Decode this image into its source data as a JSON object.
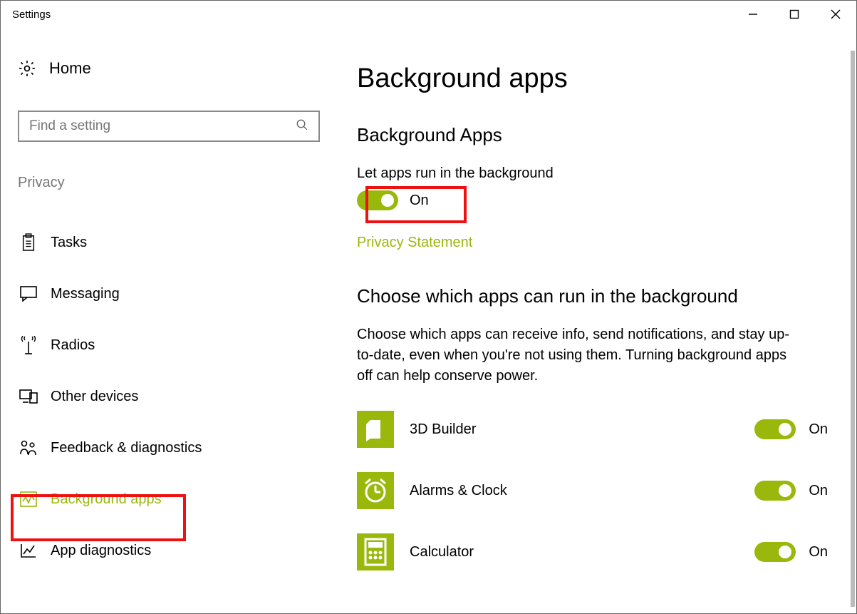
{
  "window": {
    "title": "Settings"
  },
  "sidebar": {
    "home_label": "Home",
    "search_placeholder": "Find a setting",
    "section_label": "Privacy",
    "items": [
      {
        "label": "Tasks",
        "icon": "clipboard-icon"
      },
      {
        "label": "Messaging",
        "icon": "chat-icon"
      },
      {
        "label": "Radios",
        "icon": "antenna-icon"
      },
      {
        "label": "Other devices",
        "icon": "devices-icon"
      },
      {
        "label": "Feedback & diagnostics",
        "icon": "feedback-icon"
      },
      {
        "label": "Background apps",
        "icon": "activity-icon"
      },
      {
        "label": "App diagnostics",
        "icon": "chart-icon"
      }
    ]
  },
  "main": {
    "title": "Background apps",
    "section1_heading": "Background Apps",
    "master_label": "Let apps run in the background",
    "master_state": "On",
    "privacy_link": "Privacy Statement",
    "section2_heading": "Choose which apps can run in the background",
    "section2_desc": "Choose which apps can receive info, send notifications, and stay up-to-date, even when you're not using them. Turning background apps off can help conserve power.",
    "apps": [
      {
        "name": "3D Builder",
        "state": "On"
      },
      {
        "name": "Alarms & Clock",
        "state": "On"
      },
      {
        "name": "Calculator",
        "state": "On"
      }
    ]
  },
  "colors": {
    "accent": "#9ab80b",
    "highlight": "#e11"
  }
}
